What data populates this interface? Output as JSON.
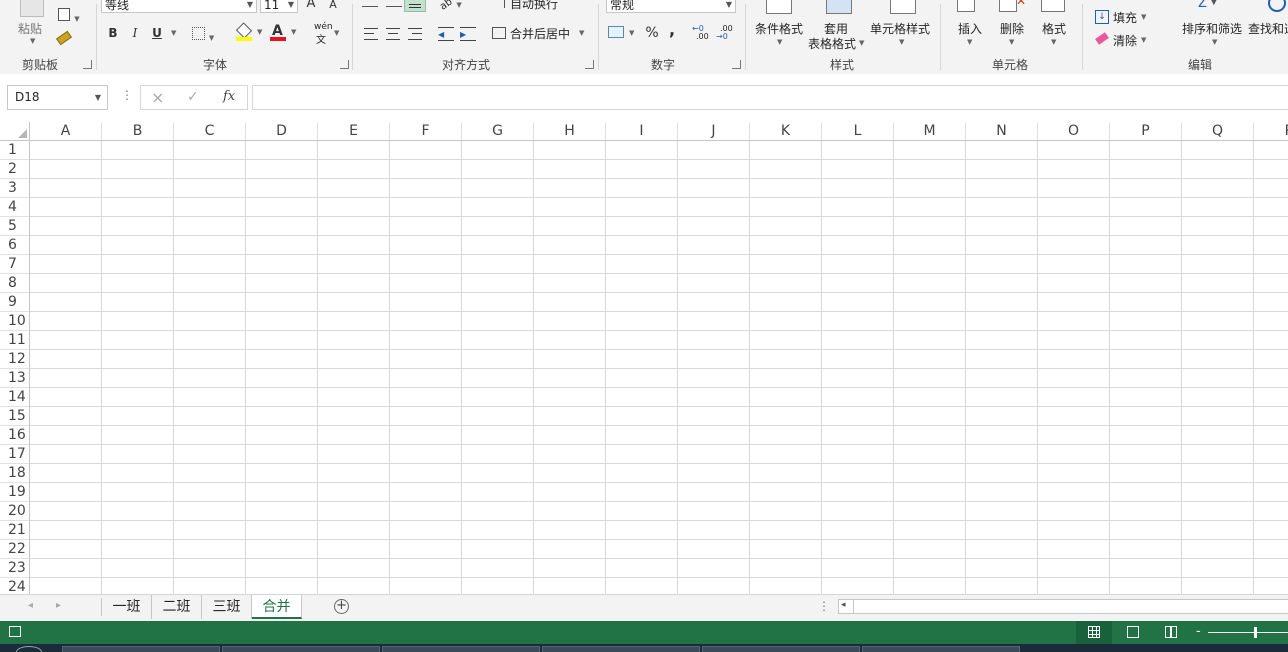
{
  "ribbon": {
    "clipboard": {
      "paste_label": "粘贴",
      "group_label": "剪贴板"
    },
    "font": {
      "font_name": "等线",
      "font_size": "11",
      "grow_label": "A",
      "shrink_label": "A",
      "bold_label": "B",
      "italic_label": "I",
      "underline_label": "U",
      "font_color_label": "A",
      "phonetic_label": "wén",
      "group_label": "字体"
    },
    "alignment": {
      "wrap_text_label": "自动换行",
      "merge_center_label": "合并后居中",
      "group_label": "对齐方式"
    },
    "number": {
      "format_value": "常规",
      "percent_label": "%",
      "comma_label": ",",
      "increase_decimal_label": ".00",
      "decrease_decimal_label": ".00",
      "group_label": "数字"
    },
    "styles": {
      "conditional_format_label": "条件格式",
      "table_format_label_1": "套用",
      "table_format_label_2": "表格格式",
      "cell_styles_label": "单元格样式",
      "group_label": "样式"
    },
    "cells": {
      "insert_label": "插入",
      "delete_label": "删除",
      "format_label": "格式",
      "group_label": "单元格"
    },
    "editing": {
      "fill_label": "填充",
      "clear_label": "清除",
      "sort_filter_label": "排序和筛选",
      "find_select_label": "查找和选",
      "group_label": "编辑"
    }
  },
  "formula_bar": {
    "name_box_value": "D18",
    "cancel_icon": "×",
    "enter_icon": "✓",
    "fx_label": "fx",
    "formula_value": ""
  },
  "grid": {
    "columns": [
      "A",
      "B",
      "C",
      "D",
      "E",
      "F",
      "G",
      "H",
      "I",
      "J",
      "K",
      "L",
      "M",
      "N",
      "O",
      "P",
      "Q",
      "R"
    ],
    "rows": [
      "1",
      "2",
      "3",
      "4",
      "5",
      "6",
      "7",
      "8",
      "9",
      "10",
      "11",
      "12",
      "13",
      "14",
      "15",
      "16",
      "17",
      "18",
      "19",
      "20",
      "21",
      "22",
      "23",
      "24"
    ]
  },
  "sheets": {
    "tabs": [
      {
        "label": "一班",
        "active": false
      },
      {
        "label": "二班",
        "active": false
      },
      {
        "label": "三班",
        "active": false
      },
      {
        "label": "合并",
        "active": true
      }
    ],
    "add_sheet_label": "+"
  },
  "colors": {
    "accent": "#217346",
    "ribbon_bg": "#f3f3f3",
    "grid_line": "#d9d9d9"
  }
}
